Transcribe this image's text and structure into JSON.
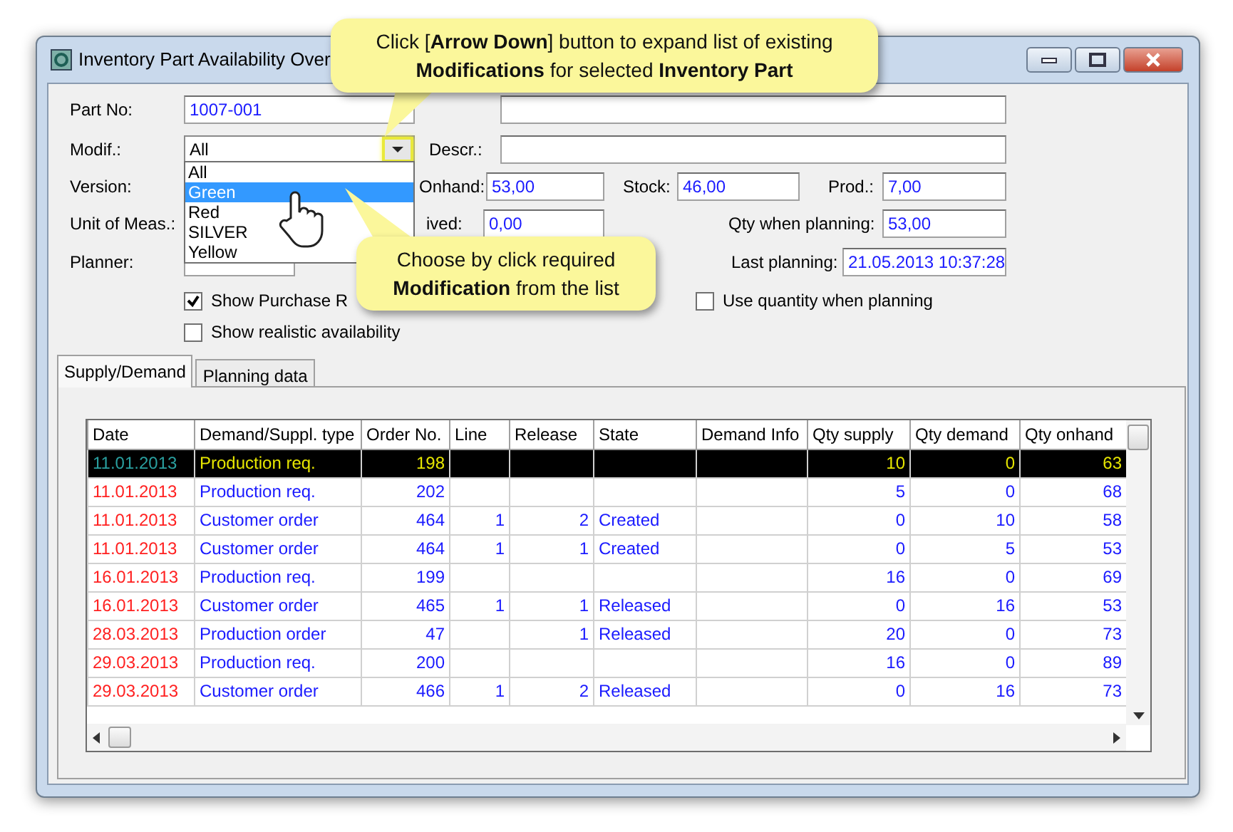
{
  "window": {
    "title": "Inventory Part Availability Over"
  },
  "form_rows": [
    [
      {
        "kind": "label",
        "text": "Part No:"
      },
      {
        "kind": "field",
        "value": "1007-001"
      },
      {
        "kind": "field"
      }
    ],
    [
      {
        "kind": "label",
        "text": "Modif.:"
      },
      {
        "kind": "combo",
        "value": "All",
        "expanded": true
      },
      {
        "kind": "label",
        "text": "Descr.:"
      },
      {
        "kind": "field"
      }
    ],
    [
      {
        "kind": "label",
        "text": "Version:"
      },
      {
        "kind": "label",
        "text": "Onhand:"
      },
      {
        "kind": "field",
        "value": "53,00"
      },
      {
        "kind": "label",
        "text": "Stock:"
      },
      {
        "kind": "field",
        "value": "46,00"
      },
      {
        "kind": "label",
        "text": "Prod.:"
      },
      {
        "kind": "field",
        "value": "7,00"
      }
    ],
    [
      {
        "kind": "label",
        "text": "Unit of Meas.:"
      },
      {
        "kind": "label",
        "text": "ived:"
      },
      {
        "kind": "field",
        "value": "0,00"
      },
      {
        "kind": "label",
        "text": "Qty when planning:"
      },
      {
        "kind": "field",
        "value": "53,00"
      }
    ],
    [
      {
        "kind": "label",
        "text": "Planner:"
      },
      {
        "kind": "field"
      },
      {
        "kind": "label",
        "text": "Last planning:"
      },
      {
        "kind": "field",
        "value": "21.05.2013 10:37:28"
      }
    ],
    [
      {
        "kind": "checkbox",
        "text": "Show Purchase R",
        "checked": true
      },
      {
        "kind": "checkbox",
        "text": "Use quantity when planning",
        "checked": false
      }
    ],
    [
      {
        "kind": "checkbox",
        "text": "Show realistic availability",
        "checked": false
      }
    ]
  ],
  "dropdown_list": [
    {
      "text": "All",
      "selected": false
    },
    {
      "text": "Green",
      "selected": true
    },
    {
      "text": "Red",
      "selected": false
    },
    {
      "text": "SILVER",
      "selected": false
    },
    {
      "text": "Yellow",
      "selected": false
    }
  ],
  "tabs": [
    {
      "label": "Supply/Demand",
      "selected": true
    },
    {
      "label": "Planning data",
      "selected": false
    }
  ],
  "table": {
    "columns": [
      "Date",
      "Demand/Suppl. type",
      "Order No.",
      "Line",
      "Release",
      "State",
      "Demand Info",
      "Qty supply",
      "Qty demand",
      "Qty onhand"
    ],
    "rows": [
      {
        "selected": true,
        "cells": [
          "11.01.2013",
          "Production req.",
          "198",
          "",
          "",
          "",
          "",
          "10",
          "0",
          "63"
        ]
      },
      {
        "selected": false,
        "cells": [
          "11.01.2013",
          "Production req.",
          "202",
          "",
          "",
          "",
          "",
          "5",
          "0",
          "68"
        ]
      },
      {
        "selected": false,
        "cells": [
          "11.01.2013",
          "Customer order",
          "464",
          "1",
          "2",
          "Created",
          "",
          "0",
          "10",
          "58"
        ]
      },
      {
        "selected": false,
        "cells": [
          "11.01.2013",
          "Customer order",
          "464",
          "1",
          "1",
          "Created",
          "",
          "0",
          "5",
          "53"
        ]
      },
      {
        "selected": false,
        "cells": [
          "16.01.2013",
          "Production req.",
          "199",
          "",
          "",
          "",
          "",
          "16",
          "0",
          "69"
        ]
      },
      {
        "selected": false,
        "cells": [
          "16.01.2013",
          "Customer order",
          "465",
          "1",
          "1",
          "Released",
          "",
          "0",
          "16",
          "53"
        ]
      },
      {
        "selected": false,
        "cells": [
          "28.03.2013",
          "Production order",
          "47",
          "",
          "1",
          "Released",
          "",
          "20",
          "0",
          "73"
        ]
      },
      {
        "selected": false,
        "cells": [
          "29.03.2013",
          "Production req.",
          "200",
          "",
          "",
          "",
          "",
          "16",
          "0",
          "89"
        ]
      },
      {
        "selected": false,
        "cells": [
          "29.03.2013",
          "Customer order",
          "466",
          "1",
          "2",
          "Released",
          "",
          "0",
          "16",
          "73"
        ]
      }
    ]
  },
  "callouts": [
    {
      "text": "Click [**Arrow Down**] button to expand list of existing **Modifications** for selected **Inventory Part**"
    },
    {
      "text": "Choose by click required **Modification** from the list"
    }
  ]
}
